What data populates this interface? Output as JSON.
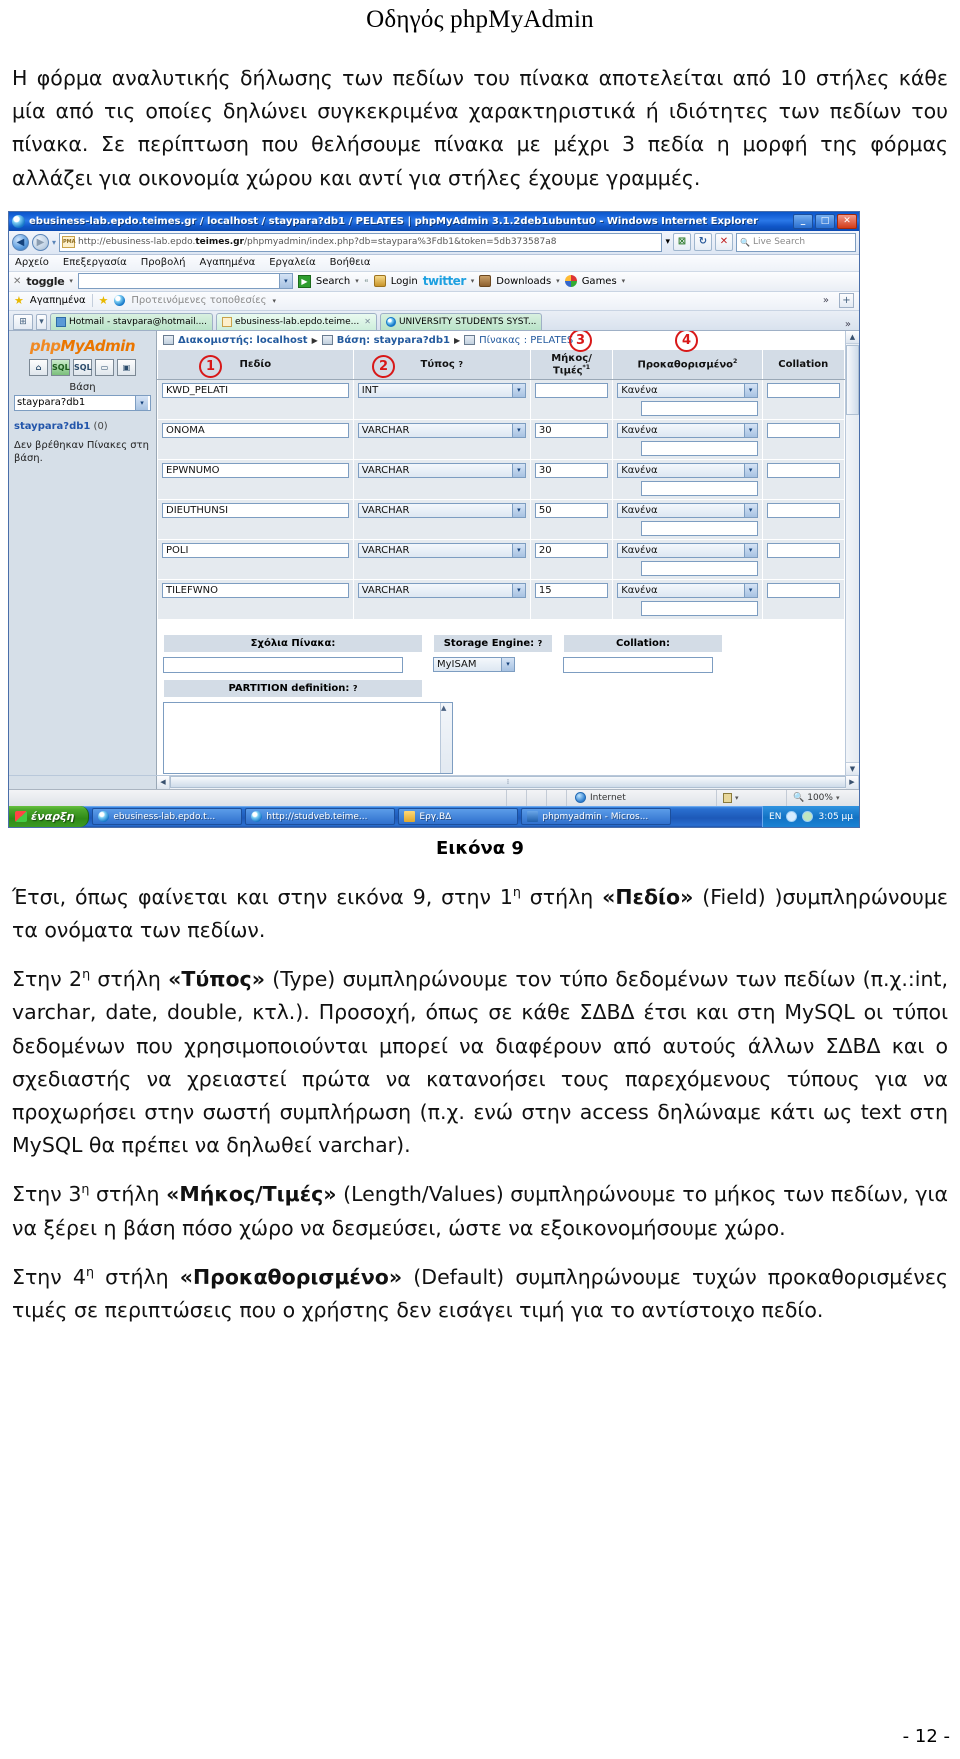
{
  "document": {
    "header_title": "Οδηγός phpMyAdmin",
    "page_number": "- 12 -",
    "intro_paragraph_1": "Η φόρμα αναλυτικής δήλωσης των πεδίων του πίνακα αποτελείται από 10 στήλες κάθε μία από τις οποίες δηλώνει συγκεκριμένα χαρακτηριστικά ή ιδιότητες των πεδίων του πίνακα.  Σε περίπτωση που θελήσουμε πίνακα με μέχρι 3 πεδία η μορφή της φόρμας αλλάζει για οικονομία χώρου και αντί για στήλες έχουμε γραμμές.",
    "figure_caption": "Εικόνα 9",
    "para_field_part1": "Έτσι, όπως φαίνεται και στην εικόνα 9, στην 1",
    "para_field_sup": "η",
    "para_field_part2": " στήλη ",
    "para_field_bold": "«Πεδίο»",
    "para_field_part3": " (Field) )συμπληρώνουμε τα ονόματα των πεδίων.",
    "para_type_part1": "Στην 2",
    "para_type_sup": "η",
    "para_type_part2": " στήλη ",
    "para_type_bold": "«Τύπος»",
    "para_type_part3": " (Type) συμπληρώνουμε τον τύπο δεδομένων των πεδίων (π.χ.:int, varchar, date, double, κτλ.).  Προσοχή, όπως σε κάθε ΣΔΒΔ έτσι και στη MySQL οι τύποι δεδομένων που χρησιμοποιούνται μπορεί να διαφέρουν από αυτούς άλλων ΣΔΒΔ και ο σχεδιαστής να χρειαστεί πρώτα να κατανοήσει τους παρεχόμενους τύπους για να προχωρήσει στην σωστή συμπλήρωση (π.χ. ενώ στην access δηλώναμε κάτι ως text στη MySQL θα πρέπει να δηλωθεί varchar).",
    "para_length_part1": "Στην 3",
    "para_length_sup": "η",
    "para_length_part2": " στήλη ",
    "para_length_bold": "«Μήκος/Τιμές»",
    "para_length_part3": " (Length/Values) συμπληρώνουμε το μήκος των πεδίων, για να ξέρει η βάση πόσο χώρο να δεσμεύσει, ώστε να εξοικονομήσουμε χώρο.",
    "para_default_part1": "Στην 4",
    "para_default_sup": "η",
    "para_default_part2": " στήλη ",
    "para_default_bold": "«Προκαθορισμένο»",
    "para_default_part3": " (Default) συμπληρώνουμε τυχών προκαθορισμένες τιμές σε περιπτώσεις που ο χρήστης δεν εισάγει τιμή για το αντίστοιχο πεδίο."
  },
  "screenshot": {
    "window": {
      "title": "ebusiness-lab.epdo.teimes.gr / localhost / staypara?db1 / PELATES | phpMyAdmin 3.1.2deb1ubuntu0 - Windows Internet Explorer",
      "minimize": "_",
      "maximize": "□",
      "close": "✕"
    },
    "navbar": {
      "back": "◀",
      "forward": "▶",
      "history_caret": "▾",
      "url_prefix": "http://ebusiness-lab.epdo.",
      "url_domain": "teimes.gr",
      "url_suffix": "/phpmyadmin/index.php?db=staypara%3Fdb1&token=5db373587a8",
      "address_caret": "▾",
      "pma_icon_label": "PMA",
      "feed_button": "⊠",
      "refresh_button": "↻",
      "stop_button": "✕",
      "live_search_placeholder": "Live Search",
      "search_icon": "🔍"
    },
    "menubar": [
      "Αρχείο",
      "Επεξεργασία",
      "Προβολή",
      "Αγαπημένα",
      "Εργαλεία",
      "Βοήθεια"
    ],
    "google_toolbar": {
      "close": "✕",
      "toggle_label": "toggle",
      "toggle_caret": "▾",
      "search_value": "",
      "search_caret": "▾",
      "search_button": "Search",
      "search_button_caret": "▾",
      "login_label": "Login",
      "twitter_label": "twitter",
      "twitter_caret": "▾",
      "downloads_label": "Downloads",
      "downloads_caret": "▾",
      "games_label": "Games",
      "games_caret": "▾"
    },
    "favorites_bar": {
      "favorites_label": "Αγαπημένα",
      "suggested_label": "Προτεινόμενες τοποθεσίες",
      "suggested_caret": "▾",
      "overflow": "»",
      "add_plus": "+"
    },
    "tabs": {
      "quick_tabs": "⊞",
      "quick_caret": "▾",
      "items": [
        {
          "label": "Hotmail - stavpara@hotmail....",
          "icon": "mail-icon",
          "active": false
        },
        {
          "label": "ebusiness-lab.epdo.teime...",
          "icon": "pma-icon",
          "active": true,
          "close": "✕"
        },
        {
          "label": "UNIVERSITY STUDENTS SYST...",
          "icon": "ie-icon",
          "active": false
        }
      ],
      "overflow_arrow": "»"
    },
    "pma_sidebar": {
      "logo_php": "php",
      "logo_my": "My",
      "logo_admin": "Admin",
      "icons": [
        "home-icon",
        "sql-export-icon",
        "sql-icon",
        "comment-icon",
        "search-icon"
      ],
      "icon_glyphs": [
        "⌂",
        "SQL",
        "SQL",
        "▭",
        "▣"
      ],
      "db_label": "Βάση",
      "db_selected": "staypara?db1",
      "db_caret": "▾",
      "db_name": "staypara?db1",
      "db_count": "(0)",
      "no_tables_note": "Δεν βρέθηκαν Πίνακες στη βάση."
    },
    "breadcrumb": {
      "server_label": "Διακομιστής: localhost",
      "sep": "▶",
      "db_label": "Βάση: staypara?db1",
      "table_label": "Πίνακας : PELATES"
    },
    "table": {
      "headers": {
        "field": "Πεδίο",
        "type": "Τύπος",
        "type_help": "?",
        "length": "Μήκος/Τιμές",
        "length_sup": "*1",
        "default": "Προκαθορισμένο",
        "default_sup": "2",
        "collation": "Collation"
      },
      "callouts": [
        "1",
        "2",
        "3",
        "4"
      ],
      "rows": [
        {
          "field": "KWD_PELATI",
          "type": "INT",
          "length": "",
          "default": "Κανένα",
          "default_extra": "",
          "collation": ""
        },
        {
          "field": "ONOMA",
          "type": "VARCHAR",
          "length": "30",
          "default": "Κανένα",
          "default_extra": "",
          "collation": ""
        },
        {
          "field": "EPWNUMO",
          "type": "VARCHAR",
          "length": "30",
          "default": "Κανένα",
          "default_extra": "",
          "collation": ""
        },
        {
          "field": "DIEUTHUNSI",
          "type": "VARCHAR",
          "length": "50",
          "default": "Κανένα",
          "default_extra": "",
          "collation": ""
        },
        {
          "field": "POLI",
          "type": "VARCHAR",
          "length": "20",
          "default": "Κανένα",
          "default_extra": "",
          "collation": ""
        },
        {
          "field": "TILEFWNO",
          "type": "VARCHAR",
          "length": "15",
          "default": "Κανένα",
          "default_extra": "",
          "collation": ""
        }
      ],
      "select_caret": "▾"
    },
    "table_options": {
      "comments_label": "Σχόλια Πίνακα:",
      "comments_value": "",
      "partition_label": "PARTITION definition:",
      "partition_help": "?",
      "partition_value": "",
      "storage_engine_label": "Storage Engine:",
      "storage_engine_help": "?",
      "storage_engine_value": "MyISAM",
      "storage_caret": "▾",
      "collation_label": "Collation:",
      "collation_value": ""
    },
    "scrollbars": {
      "up": "▲",
      "down": "▼",
      "left": "◀",
      "right": "▶",
      "grip": "⁞"
    },
    "statusbar": {
      "zone_label": "Internet",
      "zoom_label": "100%",
      "zoom_caret": "▾",
      "protected_icon": "lock-icon"
    },
    "taskbar": {
      "start_label": "έναρξη",
      "buttons": [
        {
          "label": "ebusiness-lab.epdo.t...",
          "icon": "ie-icon"
        },
        {
          "label": "http://studveb.teime...",
          "icon": "ie-icon"
        },
        {
          "label": "Εργ.ΒΔ",
          "icon": "folder-icon"
        },
        {
          "label": "phpmyadmin - Micros...",
          "icon": "word-icon"
        }
      ],
      "language": "EN",
      "time": "3:05 μμ"
    }
  }
}
